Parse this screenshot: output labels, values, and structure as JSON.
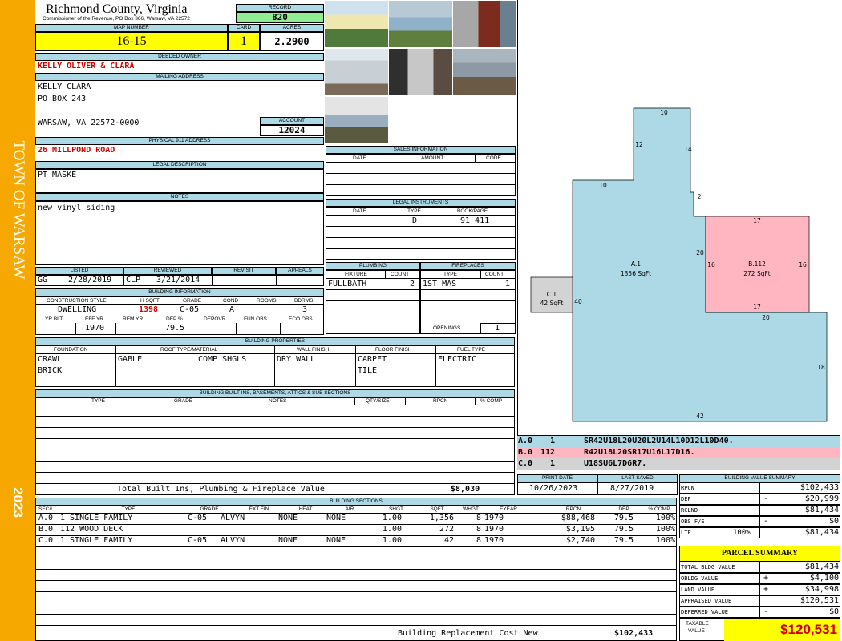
{
  "sidebar": {
    "town": "TOWN OF WARSAW",
    "year": "2023"
  },
  "header": {
    "county": "Richmond County, Virginia",
    "commissioner": "Commissioner of the Revenue, PO Box 366, Warsaw, VA 22572"
  },
  "record": {
    "label": "RECORD",
    "value": "820"
  },
  "map": {
    "label": "MAP NUMBER",
    "value": "16-15"
  },
  "card": {
    "label": "CARD",
    "value": "1"
  },
  "acres": {
    "label": "ACRES",
    "value": "2.2900"
  },
  "deeded_owner": {
    "label": "DEEDED OWNER",
    "value": "KELLY OLIVER & CLARA"
  },
  "mailing": {
    "label": "MAILING ADDRESS",
    "line1": "KELLY CLARA",
    "line2": "PO BOX 243",
    "line3": "WARSAW, VA 22572-0000"
  },
  "account": {
    "label": "ACCOUNT",
    "value": "12024"
  },
  "address911": {
    "label": "PHYSICAL 911 ADDRESS",
    "value": "26 MILLPOND ROAD"
  },
  "legal": {
    "label": "LEGAL DESCRIPTION",
    "value": "PT MASKE"
  },
  "notes": {
    "label": "NOTES",
    "value": "new vinyl siding"
  },
  "sales": {
    "label": "SALES INFORMATION",
    "cols": [
      "DATE",
      "AMOUNT",
      "CODE"
    ]
  },
  "instruments": {
    "label": "LEGAL INSTRUMENTS",
    "cols": [
      "DATE",
      "TYPE",
      "BOOK/PAGE"
    ],
    "type": "D",
    "bookpage": "91 411"
  },
  "plumbing": {
    "label": "PLUMBING",
    "col_fixture": "FIXTURE",
    "col_count": "COUNT",
    "fixture": "FULLBATH",
    "count": "2"
  },
  "fireplaces": {
    "label": "FIREPLACES",
    "col_type": "TYPE",
    "col_count": "COUNT",
    "type": "1ST MAS",
    "count": "1",
    "openings_label": "OPENINGS",
    "openings": "1"
  },
  "listed": {
    "label": "LISTED",
    "who": "GG",
    "date": "2/28/2019"
  },
  "reviewed": {
    "label": "REVIEWED",
    "who": "CLP",
    "date": "3/21/2014"
  },
  "revisit": {
    "label": "REVISIT"
  },
  "appeals": {
    "label": "APPEALS"
  },
  "building_info": {
    "label": "BUILDING INFORMATION",
    "h1": [
      "CONSTRUCTION STYLE",
      "H SQFT",
      "GRADE",
      "COND",
      "ROOMS",
      "BDRMS"
    ],
    "style": "DWELLING",
    "hsqft": "1398",
    "grade": "C-05",
    "cond": "A",
    "rooms": "",
    "bdrms": "3",
    "h2": [
      "YR BLT",
      "EFF YR",
      "REM YR",
      "DEP %",
      "DEPOVR",
      "FUN OBS",
      "ECO OBS"
    ],
    "yrblt": "",
    "effyr": "1970",
    "remyr": "",
    "dep": "79.5"
  },
  "properties": {
    "label": "BUILDING PROPERTIES",
    "cols": [
      "FOUNDATION",
      "ROOF TYPE/MATERIAL",
      "WALL FINISH",
      "FLOOR FINISH",
      "FUEL TYPE"
    ],
    "foundation1": "CRAWL",
    "foundation2": "BRICK",
    "roof1": "GABLE",
    "roof2": "COMP SHGLS",
    "wall": "DRY WALL",
    "floor1": "CARPET",
    "floor2": "TILE",
    "fuel": "ELECTRIC"
  },
  "builtins": {
    "label": "BUILDING BUILT INS, BASEMENTS, ATTICS & SUB SECTIONS",
    "cols": [
      "TYPE",
      "GRADE",
      "NOTES",
      "QTY/SIZE",
      "RPCN",
      "% COMP"
    ],
    "total_label": "Total Built Ins, Plumbing & Fireplace Value",
    "total": "$8,030"
  },
  "print": {
    "print_label": "PRINT DATE",
    "print_date": "10/26/2023",
    "saved_label": "LAST SAVED",
    "saved_date": "8/27/2019"
  },
  "sections": {
    "label": "BUILDING SECTIONS",
    "cols": [
      "SEC#",
      "TYPE",
      "GRADE",
      "EXT FIN",
      "HEAT",
      "AIR",
      "SHGT",
      "SQFT",
      "WHGT",
      "EYEAR",
      "RPCN",
      "DEP",
      "% COMP"
    ],
    "rows": [
      [
        "A.0",
        "1 SINGLE FAMILY",
        "C-05",
        "ALVYN",
        "NONE",
        "NONE",
        "1.00",
        "1,356",
        "8",
        "1970",
        "$88,468",
        "79.5",
        "100%"
      ],
      [
        "B.0",
        "112 WOOD DECK",
        "",
        "",
        "",
        "",
        "1.00",
        "272",
        "8",
        "1970",
        "$3,195",
        "79.5",
        "100%"
      ],
      [
        "C.0",
        "1 SINGLE FAMILY",
        "C-05",
        "ALVYN",
        "NONE",
        "NONE",
        "1.00",
        "42",
        "8",
        "1970",
        "$2,740",
        "79.5",
        "100%"
      ]
    ],
    "replacement_label": "Building Replacement Cost New",
    "replacement": "$102,433"
  },
  "sketch": {
    "labels": {
      "a_name": "A.1",
      "a_area": "1356 SqFt",
      "b_name": "B.112",
      "b_area": "272 SqFt",
      "c_name": "C.1",
      "c_area": "42 SqFt",
      "d10a": "10",
      "d12": "12",
      "d14": "14",
      "d10b": "10",
      "d2": "2",
      "d17a": "17",
      "d20a": "20",
      "d16a": "16",
      "d16b": "16",
      "d17b": "17",
      "d40": "40",
      "d20b": "20",
      "d18": "18",
      "d42": "42"
    },
    "vectors": [
      {
        "sec": "A.0",
        "code": "1",
        "path": "SR42U18L20U20L2U14L10D12L10D40."
      },
      {
        "sec": "B.0",
        "code": "112",
        "path": "R42U18L20SR17U16L17D16."
      },
      {
        "sec": "C.0",
        "code": "1",
        "path": "U18SU6L7D6R7."
      }
    ]
  },
  "value_summary": {
    "label": "BUILDING VALUE SUMMARY",
    "rows": [
      {
        "k": "RPCN",
        "sign": "",
        "v": "$102,433"
      },
      {
        "k": "DEP",
        "sign": "-",
        "v": "$20,999"
      },
      {
        "k": "RCLND",
        "sign": "",
        "v": "$81,434"
      },
      {
        "k": "OBS F/E",
        "sign": "-",
        "v": "$0"
      },
      {
        "k": "LTF",
        "pct": "100%",
        "sign": "",
        "v": "$81,434"
      }
    ]
  },
  "parcel": {
    "label": "PARCEL SUMMARY",
    "rows": [
      {
        "k": "TOTAL BLDG VALUE",
        "sign": "",
        "v": "$81,434"
      },
      {
        "k": "OBLDG VALUE",
        "sign": "+",
        "v": "$4,100"
      },
      {
        "k": "LAND VALUE",
        "sign": "+",
        "v": "$34,998"
      },
      {
        "k": "APPRAISED VALUE",
        "sign": "",
        "v": "$120,531"
      },
      {
        "k": "DEFERRED VALUE",
        "sign": "-",
        "v": "$0"
      }
    ],
    "taxable_label1": "TAXABLE",
    "taxable_label2": "VALUE",
    "taxable": "$120,531"
  },
  "colors": {
    "sidebar": "#f7a800",
    "header": "#add8e6",
    "highlight": "#ffff00",
    "record": "#90ee90",
    "deck": "#ffb6c1",
    "main": "#add8e6",
    "annex": "#d3d3d3"
  }
}
